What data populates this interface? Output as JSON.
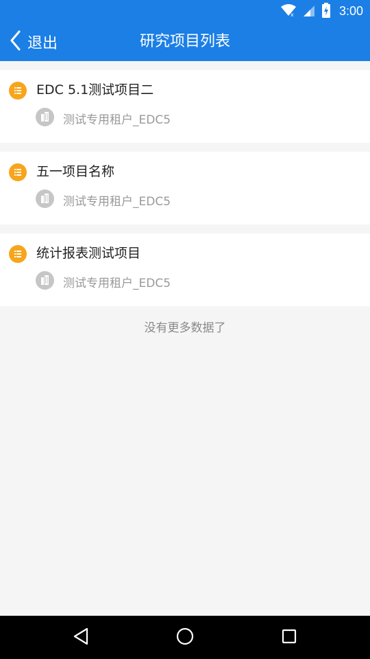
{
  "status_bar": {
    "time": "3:00",
    "icons": [
      "wifi-icon",
      "cell-signal-icon",
      "battery-charging-icon"
    ]
  },
  "header": {
    "back_label": "退出",
    "title": "研究项目列表"
  },
  "projects": [
    {
      "title": "EDC 5.1测试项目二",
      "tenant": "测试专用租户_EDC5"
    },
    {
      "title": "五一项目名称",
      "tenant": "测试专用租户_EDC5"
    },
    {
      "title": "统计报表测试项目",
      "tenant": "测试专用租户_EDC5"
    }
  ],
  "footer_text": "没有更多数据了",
  "nav": [
    "back-icon",
    "home-icon",
    "recents-icon"
  ],
  "colors": {
    "primary": "#1b7fe6",
    "project_icon": "#f7a51c",
    "tenant_icon": "#c6c6c6",
    "background": "#f5f5f5"
  }
}
